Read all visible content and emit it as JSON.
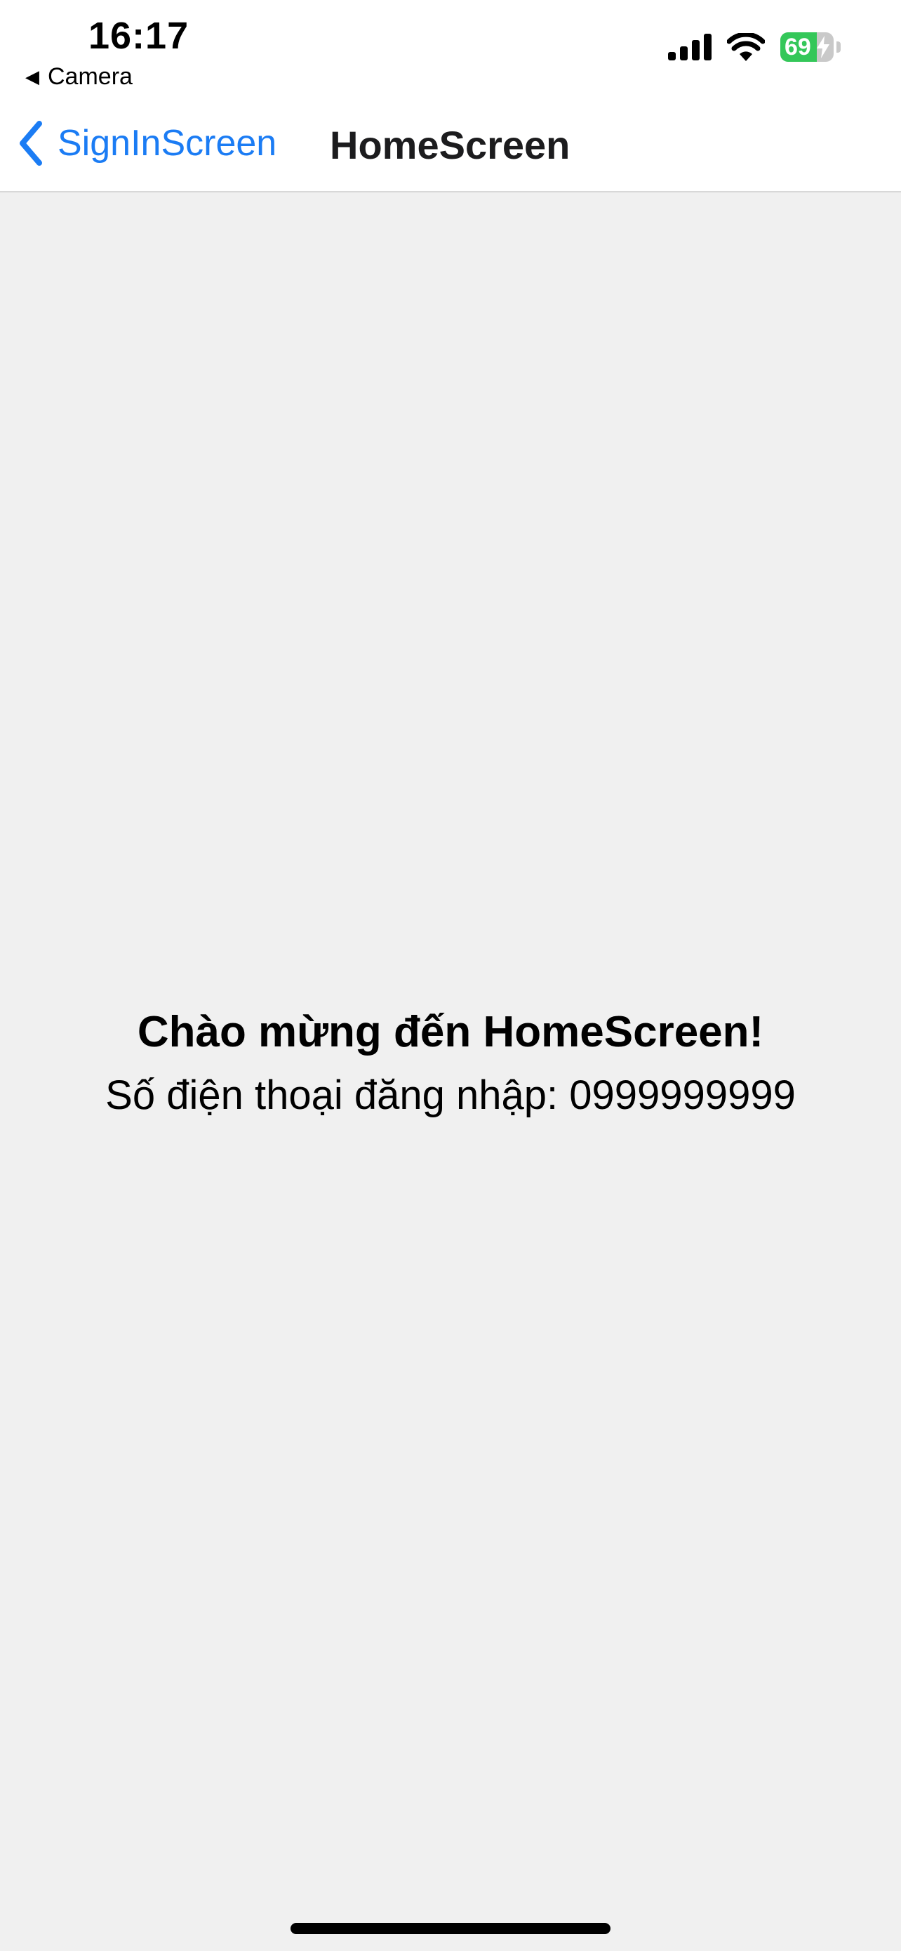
{
  "status_bar": {
    "time": "16:17",
    "back_app_label": "Camera",
    "battery_percent": "69",
    "battery_level": 0.69,
    "icons": [
      "cellular-signal-icon",
      "wifi-icon",
      "battery-icon",
      "charging-bolt-icon"
    ]
  },
  "nav": {
    "back_label": "SignInScreen",
    "title": "HomeScreen",
    "accent_color": "#1b7cf4"
  },
  "main": {
    "welcome": "Chào mừng đến HomeScreen!",
    "phone_line": "Số điện thoại đăng nhập: 0999999999"
  }
}
